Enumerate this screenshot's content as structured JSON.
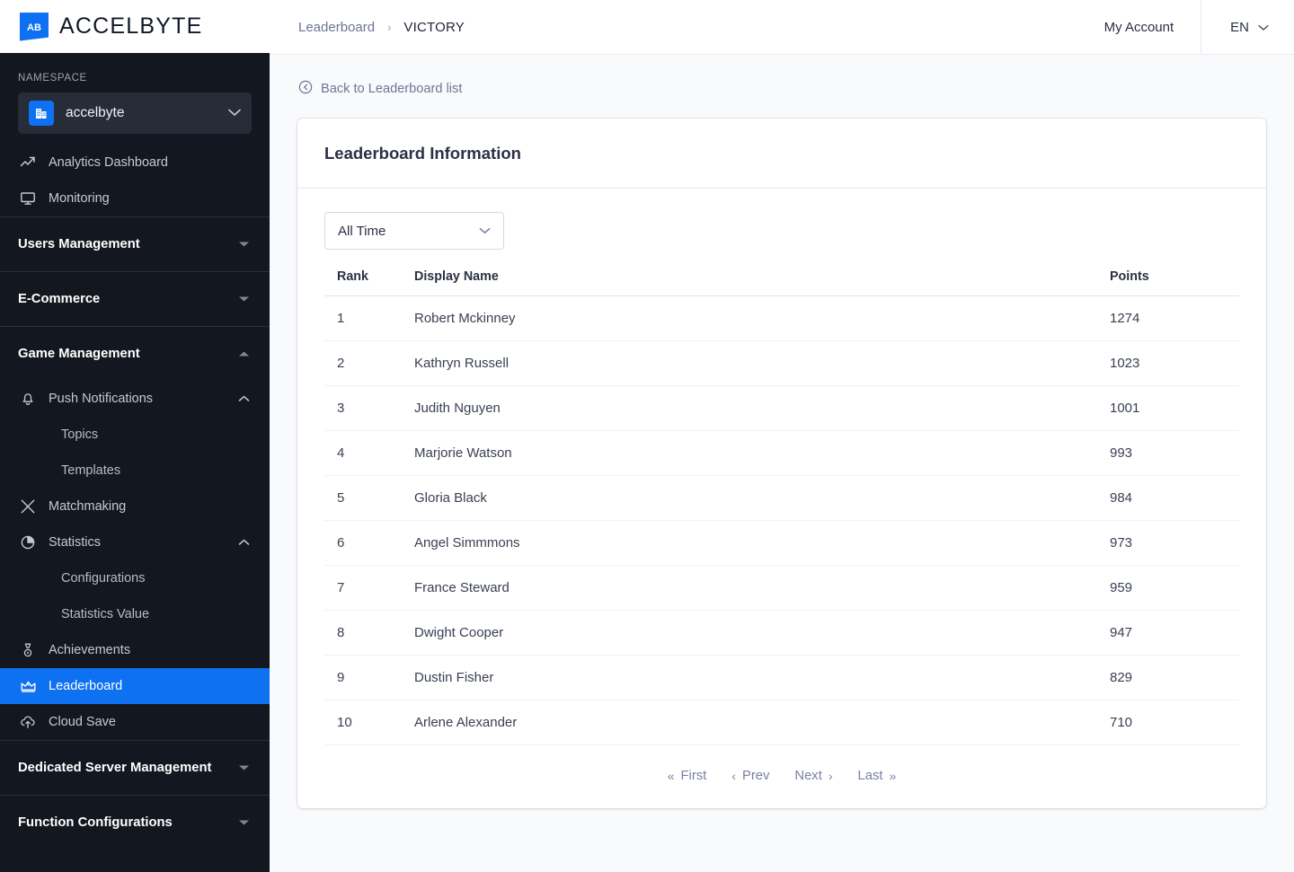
{
  "brand": {
    "name": "ACCELBYTE",
    "logo_icon": "accelbyte-logo-icon"
  },
  "sidebar": {
    "namespace_label": "NAMESPACE",
    "namespace_value": "accelbyte",
    "namespace_icon": "building-icon",
    "namespace_chevron": "chevron-down-icon",
    "items": [
      {
        "label": "Analytics Dashboard",
        "icon": "trending-up-icon",
        "type": "link"
      },
      {
        "label": "Monitoring",
        "icon": "monitor-icon",
        "type": "link"
      },
      {
        "label": "Users Management",
        "icon": "",
        "type": "section",
        "caret": "caret-down-icon"
      },
      {
        "label": "E-Commerce",
        "icon": "",
        "type": "section",
        "caret": "caret-down-icon"
      },
      {
        "label": "Game Management",
        "icon": "",
        "type": "section",
        "caret": "caret-up-icon"
      },
      {
        "label": "Push Notifications",
        "icon": "bell-icon",
        "type": "group",
        "caret": "chevron-up-icon"
      },
      {
        "label": "Topics",
        "icon": "",
        "type": "sub"
      },
      {
        "label": "Templates",
        "icon": "",
        "type": "sub"
      },
      {
        "label": "Matchmaking",
        "icon": "swords-icon",
        "type": "link"
      },
      {
        "label": "Statistics",
        "icon": "pie-chart-icon",
        "type": "group",
        "caret": "chevron-up-icon"
      },
      {
        "label": "Configurations",
        "icon": "",
        "type": "sub"
      },
      {
        "label": "Statistics Value",
        "icon": "",
        "type": "sub"
      },
      {
        "label": "Achievements",
        "icon": "medal-icon",
        "type": "link"
      },
      {
        "label": "Leaderboard",
        "icon": "crown-icon",
        "type": "link",
        "active": true
      },
      {
        "label": "Cloud Save",
        "icon": "cloud-upload-icon",
        "type": "link"
      },
      {
        "label": "Dedicated Server Management",
        "icon": "",
        "type": "section",
        "caret": "caret-down-icon"
      },
      {
        "label": "Function Configurations",
        "icon": "",
        "type": "section",
        "caret": "caret-down-icon"
      }
    ]
  },
  "topbar": {
    "breadcrumb_root": "Leaderboard",
    "breadcrumb_sep": "›",
    "breadcrumb_current": "VICTORY",
    "my_account": "My Account",
    "language": "EN",
    "language_chevron": "chevron-down-icon"
  },
  "back_link": {
    "label": "Back to Leaderboard list",
    "icon": "arrow-left-circle-icon"
  },
  "card": {
    "title": "Leaderboard Information",
    "time_filter": {
      "value": "All Time",
      "chevron": "chevron-down-icon"
    }
  },
  "table": {
    "columns": [
      "Rank",
      "Display Name",
      "Points"
    ],
    "rows": [
      {
        "rank": "1",
        "name": "Robert Mckinney",
        "points": "1274"
      },
      {
        "rank": "2",
        "name": "Kathryn Russell",
        "points": "1023"
      },
      {
        "rank": "3",
        "name": "Judith Nguyen",
        "points": "1001"
      },
      {
        "rank": "4",
        "name": "Marjorie Watson",
        "points": "993"
      },
      {
        "rank": "5",
        "name": "Gloria Black",
        "points": "984"
      },
      {
        "rank": "6",
        "name": "Angel Simmmons",
        "points": "973"
      },
      {
        "rank": "7",
        "name": "France Steward",
        "points": "959"
      },
      {
        "rank": "8",
        "name": "Dwight Cooper",
        "points": "947"
      },
      {
        "rank": "9",
        "name": "Dustin Fisher",
        "points": "829"
      },
      {
        "rank": "10",
        "name": "Arlene Alexander",
        "points": "710"
      }
    ]
  },
  "pagination": {
    "first": "First",
    "first_sym": "«",
    "prev": "Prev",
    "prev_sym": "‹",
    "next": "Next",
    "next_sym": "›",
    "last": "Last",
    "last_sym": "»"
  },
  "colors": {
    "accent": "#0d71f2",
    "sidebar_bg": "#13171f",
    "content_bg": "#f9fafb",
    "text_dark": "#2b3043",
    "muted": "#6f7596"
  }
}
